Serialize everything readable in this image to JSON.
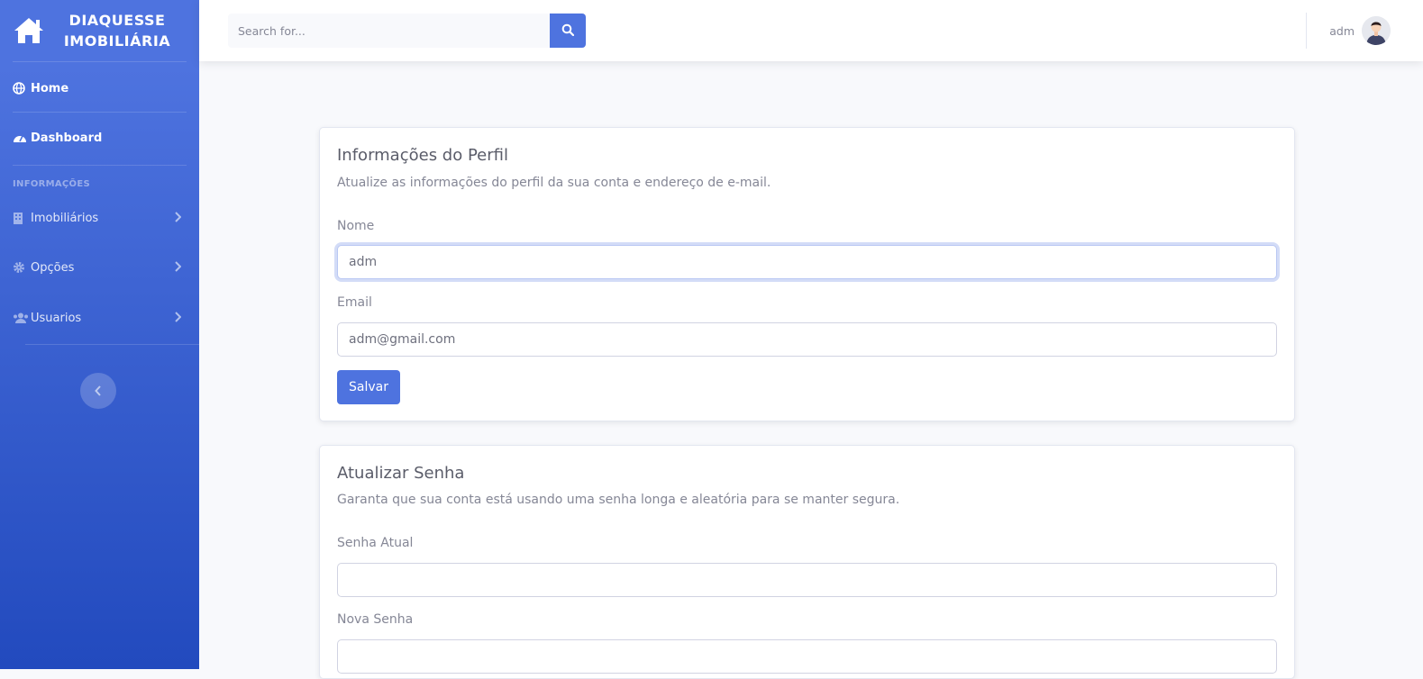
{
  "brand": {
    "line1": "DIAQUESSE",
    "line2": "IMOBILIÁRIA"
  },
  "sidebar": {
    "items": [
      {
        "label": "Home",
        "icon": "globe-icon"
      },
      {
        "label": "Dashboard",
        "icon": "tachometer-icon"
      }
    ],
    "section_heading": "INFORMAÇÕES",
    "sub_items": [
      {
        "label": "Imobiliários",
        "icon": "building-icon"
      },
      {
        "label": "Opções",
        "icon": "cog-icon"
      },
      {
        "label": "Usuarios",
        "icon": "users-icon"
      }
    ]
  },
  "topbar": {
    "search_placeholder": "Search for...",
    "user_name": "adm"
  },
  "profile_card": {
    "title": "Informações do Perfil",
    "description": "Atualize as informações do perfil da sua conta e endereço de e-mail.",
    "name_label": "Nome",
    "name_value": "adm",
    "email_label": "Email",
    "email_value": "adm@gmail.com",
    "save_label": "Salvar"
  },
  "password_card": {
    "title": "Atualizar Senha",
    "description": "Garanta que sua conta está usando uma senha longa e aleatória para se manter segura.",
    "current_label": "Senha Atual",
    "current_value": "",
    "new_label": "Nova Senha",
    "new_value": ""
  },
  "colors": {
    "primary": "#4e73df",
    "primary_dark": "#224abe",
    "body_bg": "#f8f9fc",
    "text_muted": "#858796"
  }
}
